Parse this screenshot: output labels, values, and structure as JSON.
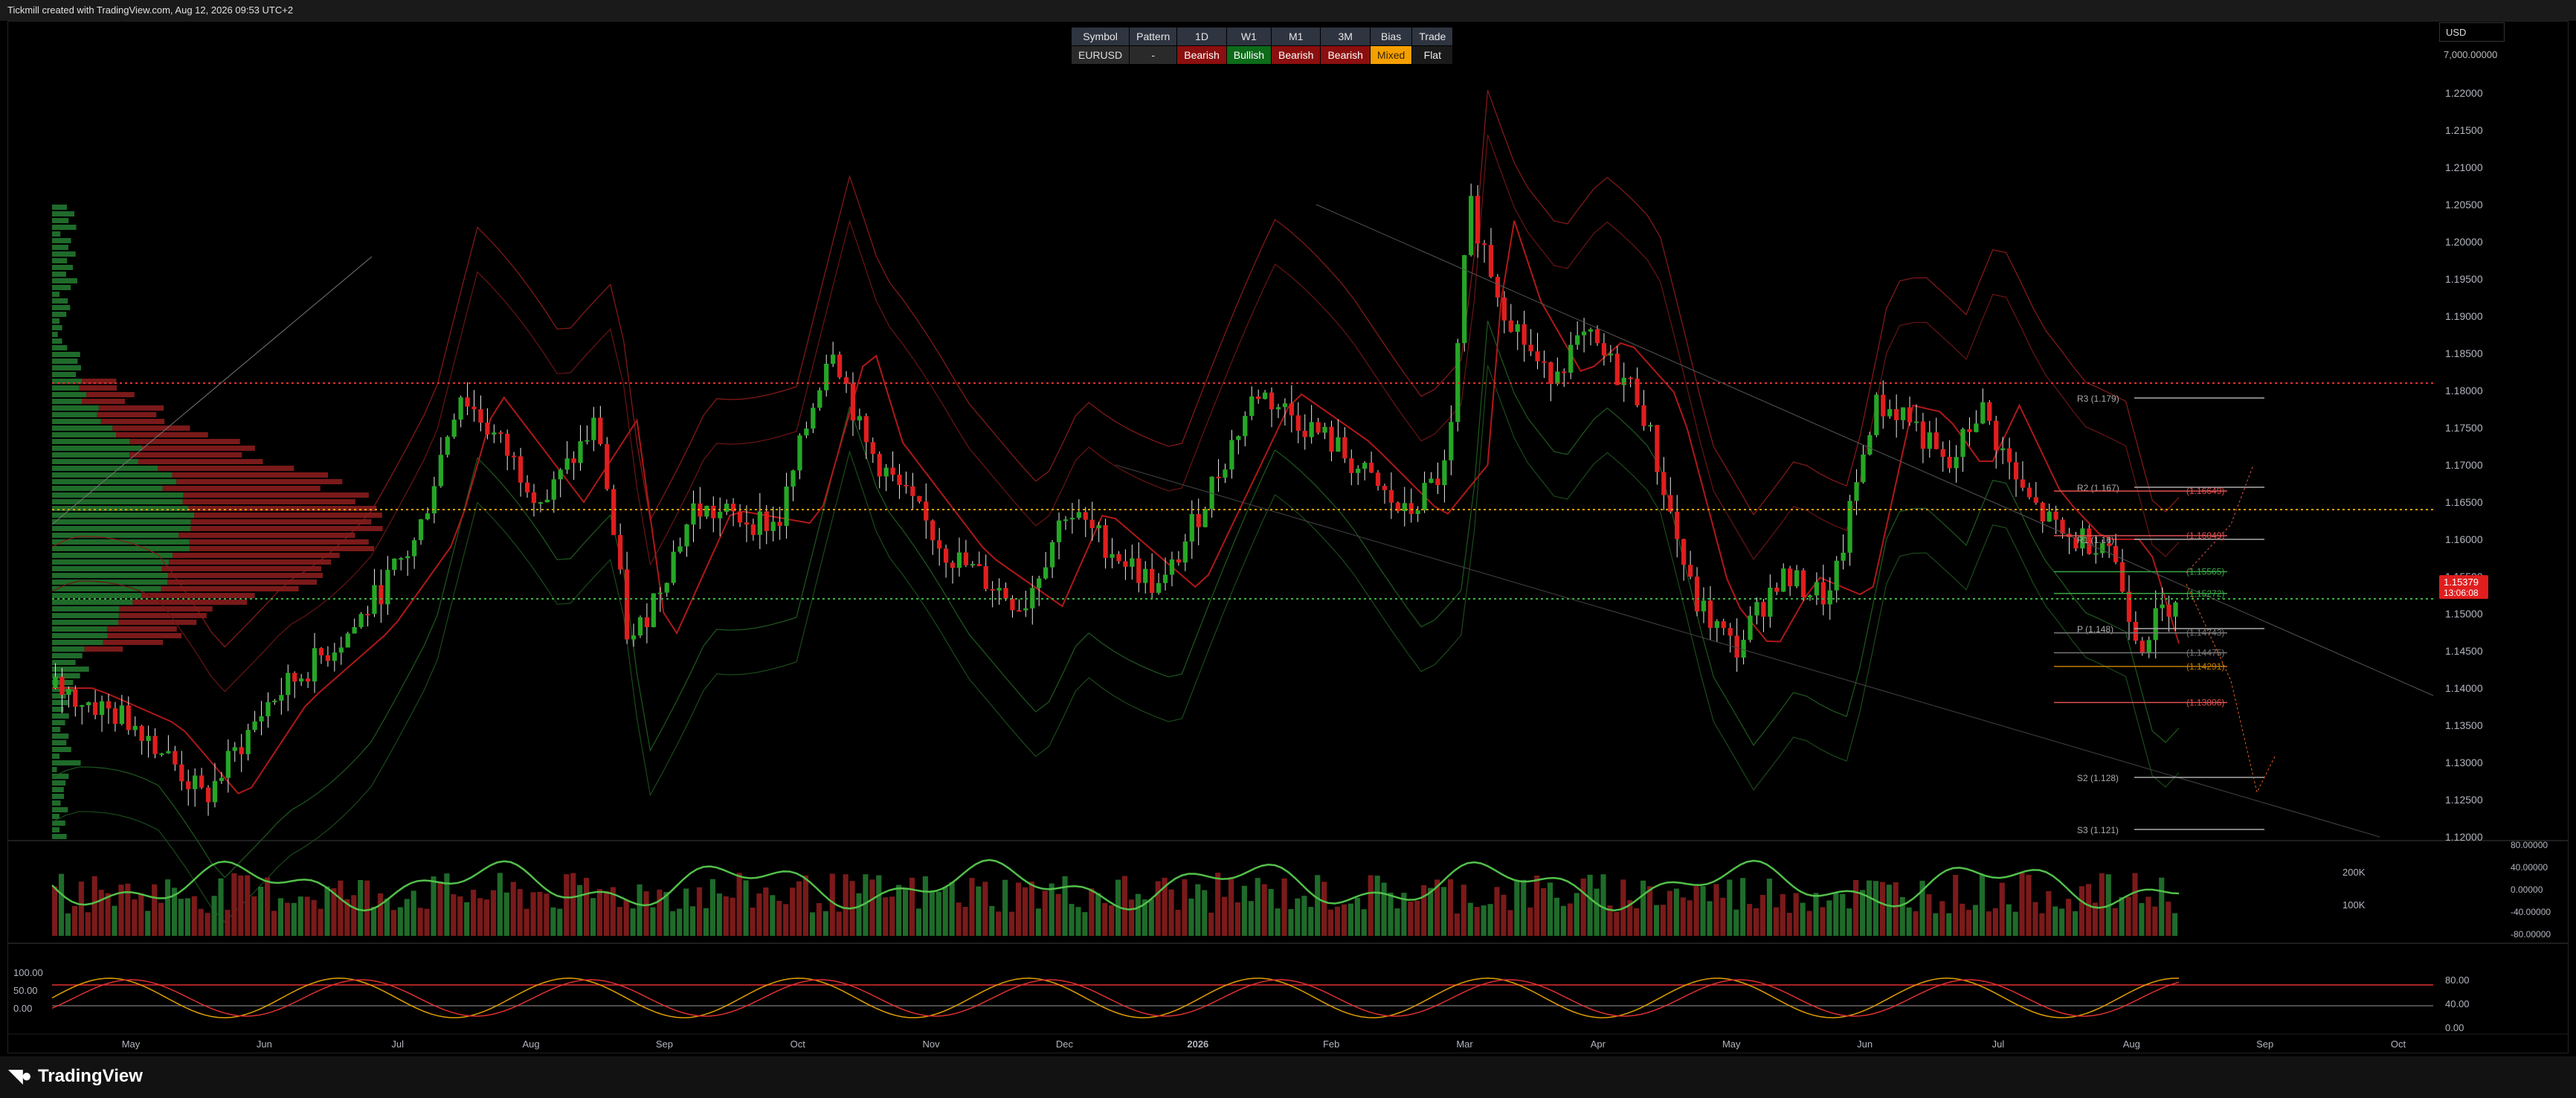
{
  "header": {
    "caption": "Tickmill created with TradingView.com, Aug 12, 2026 09:53 UTC+2"
  },
  "footer": {
    "brand": "TradingView"
  },
  "currency": {
    "selected": "USD"
  },
  "account_value": "7,000.00000",
  "bias_table": {
    "headers": [
      "Symbol",
      "Pattern",
      "1D",
      "W1",
      "M1",
      "3M",
      "Bias",
      "Trade"
    ],
    "row": [
      {
        "text": "EURUSD",
        "style": "default"
      },
      {
        "text": "-",
        "style": "default"
      },
      {
        "text": "Bearish",
        "style": "bearish"
      },
      {
        "text": "Bullish",
        "style": "bullish"
      },
      {
        "text": "Bearish",
        "style": "bearish"
      },
      {
        "text": "Bearish",
        "style": "bearish"
      },
      {
        "text": "Mixed",
        "style": "mixed"
      },
      {
        "text": "Flat",
        "style": "flat"
      }
    ]
  },
  "chart_data": {
    "type": "candlestick",
    "symbol": "EURUSD",
    "price_axis_ticks": [
      "1.22000",
      "1.21500",
      "1.21000",
      "1.20500",
      "1.20000",
      "1.19500",
      "1.19000",
      "1.18500",
      "1.18000",
      "1.17500",
      "1.17000",
      "1.16500",
      "1.16000",
      "1.15500",
      "1.15000",
      "1.14500",
      "1.14000",
      "1.13500",
      "1.13000",
      "1.12500",
      "1.12000"
    ],
    "ylim": [
      1.1195,
      1.2225
    ],
    "time_axis_labels": [
      "May",
      "Jun",
      "Jul",
      "Aug",
      "Sep",
      "Oct",
      "Nov",
      "Dec",
      "2026",
      "Feb",
      "Mar",
      "Apr",
      "May",
      "Jun",
      "Jul",
      "Aug",
      "Sep",
      "Oct"
    ],
    "current_price": {
      "value": "1.15379",
      "countdown": "13:06:08"
    },
    "price_series_anchors": [
      {
        "t": 0,
        "price": 1.14
      },
      {
        "t": 0.04,
        "price": 1.135
      },
      {
        "t": 0.07,
        "price": 1.125
      },
      {
        "t": 0.1,
        "price": 1.138
      },
      {
        "t": 0.14,
        "price": 1.148
      },
      {
        "t": 0.17,
        "price": 1.16
      },
      {
        "t": 0.19,
        "price": 1.18
      },
      {
        "t": 0.23,
        "price": 1.165
      },
      {
        "t": 0.255,
        "price": 1.176
      },
      {
        "t": 0.27,
        "price": 1.145
      },
      {
        "t": 0.3,
        "price": 1.164
      },
      {
        "t": 0.34,
        "price": 1.162
      },
      {
        "t": 0.365,
        "price": 1.187
      },
      {
        "t": 0.38,
        "price": 1.173
      },
      {
        "t": 0.42,
        "price": 1.158
      },
      {
        "t": 0.455,
        "price": 1.151
      },
      {
        "t": 0.475,
        "price": 1.164
      },
      {
        "t": 0.52,
        "price": 1.153
      },
      {
        "t": 0.565,
        "price": 1.18
      },
      {
        "t": 0.6,
        "price": 1.173
      },
      {
        "t": 0.635,
        "price": 1.163
      },
      {
        "t": 0.655,
        "price": 1.17
      },
      {
        "t": 0.665,
        "price": 1.205
      },
      {
        "t": 0.68,
        "price": 1.192
      },
      {
        "t": 0.7,
        "price": 1.182
      },
      {
        "t": 0.72,
        "price": 1.187
      },
      {
        "t": 0.745,
        "price": 1.179
      },
      {
        "t": 0.77,
        "price": 1.152
      },
      {
        "t": 0.79,
        "price": 1.145
      },
      {
        "t": 0.81,
        "price": 1.155
      },
      {
        "t": 0.835,
        "price": 1.152
      },
      {
        "t": 0.855,
        "price": 1.178
      },
      {
        "t": 0.87,
        "price": 1.177
      },
      {
        "t": 0.89,
        "price": 1.169
      },
      {
        "t": 0.905,
        "price": 1.178
      },
      {
        "t": 0.925,
        "price": 1.166
      },
      {
        "t": 0.945,
        "price": 1.16
      },
      {
        "t": 0.965,
        "price": 1.16
      },
      {
        "t": 0.98,
        "price": 1.146
      },
      {
        "t": 1.0,
        "price": 1.154
      }
    ],
    "pivot_levels": [
      {
        "label": "R3 (1.179)",
        "price": 1.179
      },
      {
        "label": "R2 (1.167)",
        "price": 1.167
      },
      {
        "label": "R1 (1.16)",
        "price": 1.16
      },
      {
        "label": "P (1.148)",
        "price": 1.148
      },
      {
        "label": "S2 (1.128)",
        "price": 1.128
      },
      {
        "label": "S3 (1.121)",
        "price": 1.121
      }
    ],
    "projection_levels": [
      {
        "label": "(1.16649)",
        "price": 1.16649,
        "color": "#e05050"
      },
      {
        "label": "(1.16049)",
        "price": 1.16049,
        "color": "#e05050"
      },
      {
        "label": "(1.15565)",
        "price": 1.15565,
        "color": "#39a845"
      },
      {
        "label": "(1.15272)",
        "price": 1.15272,
        "color": "#39a845"
      },
      {
        "label": "(1.14743)",
        "price": 1.14743,
        "color": "#777777"
      },
      {
        "label": "(1.14475)",
        "price": 1.14475,
        "color": "#777777"
      },
      {
        "label": "(1.14291)",
        "price": 1.14291,
        "color": "#c27c00"
      },
      {
        "label": "(1.13806)",
        "price": 1.13806,
        "color": "#e05050"
      }
    ],
    "horizontal_lines": [
      {
        "price": 1.181,
        "color": "#e03030"
      },
      {
        "price": 1.164,
        "color": "#e0a000"
      },
      {
        "price": 1.152,
        "color": "#3cb043"
      }
    ],
    "volume_axis_labels": [
      "200K",
      "100K"
    ],
    "oscillator_axis_labels": [
      "80.00000",
      "40.00000",
      "0.00000",
      "-40.00000",
      "-80.00000"
    ],
    "stoch_axis_labels_left": [
      "100.00",
      "50.00",
      "0.00"
    ],
    "stoch_axis_labels_right": [
      "80.00",
      "40.00",
      "0.00"
    ],
    "stoch_levels": [
      80,
      40
    ],
    "colors": {
      "bull": "#26a626",
      "bear": "#e01e1e",
      "profile_green": "#1f6b2a",
      "profile_red": "#7a1a1a"
    }
  }
}
